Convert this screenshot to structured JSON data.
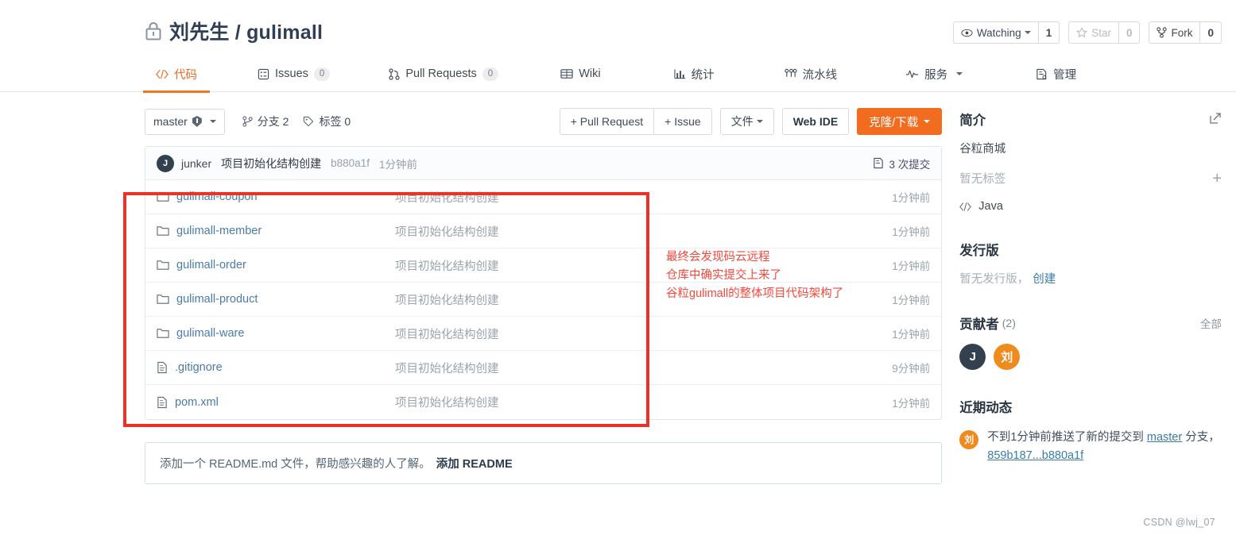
{
  "header": {
    "lock_icon": "lock-icon",
    "owner": "刘先生",
    "separator": "/",
    "repo": "gulimall",
    "watch_label": "Watching",
    "watch_count": "1",
    "star_label": "Star",
    "star_count": "0",
    "fork_label": "Fork",
    "fork_count": "0"
  },
  "nav": {
    "items": [
      {
        "label": "代码",
        "icon": "code-icon",
        "badge": "",
        "active": true
      },
      {
        "label": "Issues",
        "icon": "issue-icon",
        "badge": "0",
        "active": false
      },
      {
        "label": "Pull Requests",
        "icon": "pull-request-icon",
        "badge": "0",
        "active": false
      },
      {
        "label": "Wiki",
        "icon": "wiki-icon",
        "badge": "",
        "active": false
      },
      {
        "label": "统计",
        "icon": "chart-icon",
        "badge": "",
        "active": false
      },
      {
        "label": "流水线",
        "icon": "pipeline-icon",
        "badge": "",
        "active": false
      },
      {
        "label": "服务",
        "icon": "service-icon",
        "badge": "",
        "active": false
      },
      {
        "label": "管理",
        "icon": "manage-icon",
        "badge": "",
        "active": false
      }
    ]
  },
  "toolbar": {
    "branch": "master",
    "branches_label": "分支 2",
    "tags_label": "标签 0",
    "pull_request_button": "+ Pull Request",
    "issue_button": "+ Issue",
    "files_button": "文件",
    "web_ide_button": "Web IDE",
    "clone_button": "克隆/下载"
  },
  "commit_bar": {
    "avatar_initial": "J",
    "author": "junker",
    "message": "项目初始化结构创建",
    "sha": "b880a1f",
    "time": "1分钟前",
    "commit_count": "3 次提交"
  },
  "files": [
    {
      "name": "gulimall-coupon",
      "type": "folder",
      "message": "项目初始化结构创建",
      "time": "1分钟前"
    },
    {
      "name": "gulimall-member",
      "type": "folder",
      "message": "项目初始化结构创建",
      "time": "1分钟前"
    },
    {
      "name": "gulimall-order",
      "type": "folder",
      "message": "项目初始化结构创建",
      "time": "1分钟前"
    },
    {
      "name": "gulimall-product",
      "type": "folder",
      "message": "项目初始化结构创建",
      "time": "1分钟前"
    },
    {
      "name": "gulimall-ware",
      "type": "folder",
      "message": "项目初始化结构创建",
      "time": "1分钟前"
    },
    {
      "name": ".gitignore",
      "type": "file",
      "message": "项目初始化结构创建",
      "time": "9分钟前"
    },
    {
      "name": "pom.xml",
      "type": "file",
      "message": "项目初始化结构创建",
      "time": "1分钟前"
    }
  ],
  "annotation": {
    "color": "#f4473c",
    "line1": "最终会发现码云远程",
    "line2": "仓库中确实提交上来了",
    "line3": "谷粒gulimall的整体项目代码架构了"
  },
  "readme_banner": {
    "text": "添加一个 README.md 文件，帮助感兴趣的人了解。",
    "link": "添加 README"
  },
  "sidebar": {
    "about_title": "简介",
    "about_edit_icon": "edit-icon",
    "about_desc": "谷粒商城",
    "no_tags": "暂无标签",
    "add_tag_icon": "plus-icon",
    "language": "Java",
    "release_title": "发行版",
    "release_empty": "暂无发行版，",
    "release_create": "创建",
    "contributors_title": "贡献者",
    "contributors_count": "(2)",
    "contributors_all": "全部",
    "contributors": [
      {
        "initial": "J",
        "color": "dark"
      },
      {
        "initial": "刘",
        "color": "orange"
      }
    ],
    "activity_title": "近期动态",
    "activity": {
      "avatar_initial": "刘",
      "text_before": "不到1分钟前推送了新的提交到",
      "branch": "master",
      "text_after": "分支，",
      "sha_range": "859b187...b880a1f"
    }
  },
  "watermark": "CSDN @lwj_07",
  "colors": {
    "accent_orange": "#ef7622",
    "primary_button": "#f26c20",
    "annotation_red": "#ee3124",
    "link_blue": "#4a7ca8"
  }
}
